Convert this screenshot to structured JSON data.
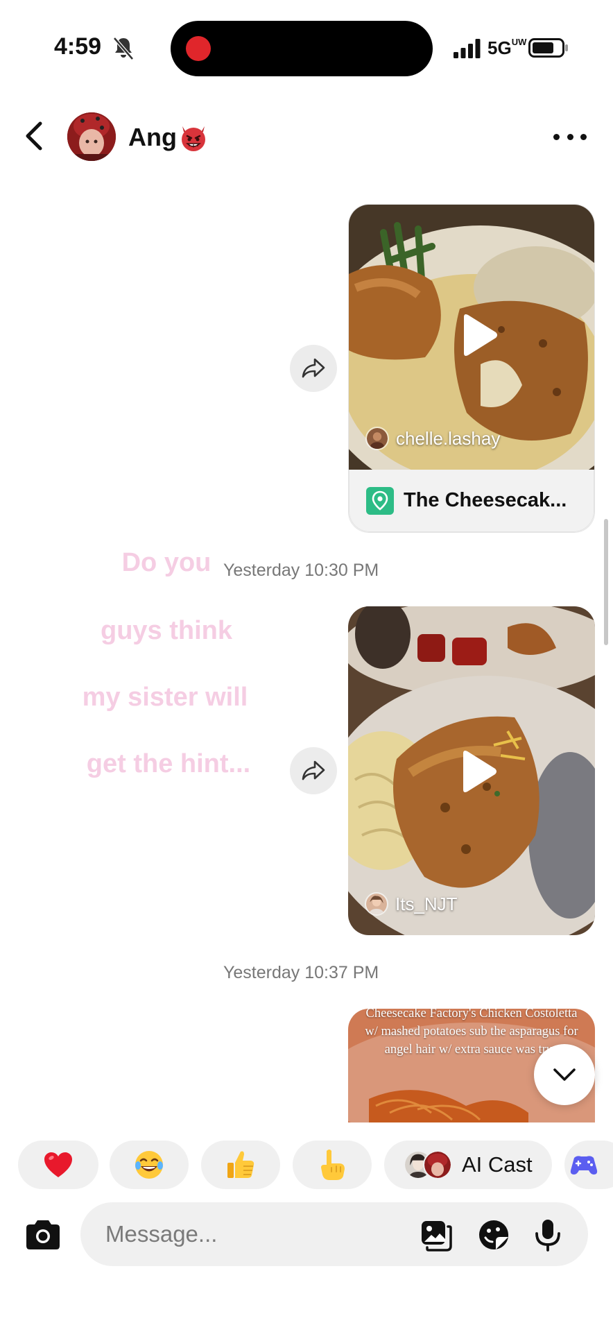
{
  "status_bar": {
    "time": "4:59",
    "network": "5G",
    "network_sub": "UW"
  },
  "header": {
    "contact_name": "Ang",
    "name_emoji_icon": "devil-face-icon"
  },
  "messages": [
    {
      "type": "shared_video",
      "author": "chelle.lashay",
      "place": "The Cheesecak..."
    },
    {
      "type": "timestamp",
      "text": "Yesterday 10:30 PM"
    },
    {
      "type": "shared_video",
      "author": "Its_NJT",
      "overlay_caption": [
        "Do you",
        "guys think",
        "my sister will",
        "get the hint..."
      ]
    },
    {
      "type": "timestamp",
      "text": "Yesterday 10:37 PM"
    },
    {
      "type": "shared_video",
      "caption": "Cheesecake Factory's Chicken Costoletta w/ mashed potatoes sub the asparagus for angel hair w/ extra sauce was true"
    }
  ],
  "quick_reactions": [
    {
      "emoji": "❤️",
      "icon": "heart-icon"
    },
    {
      "emoji": "😂",
      "icon": "laughing-icon"
    },
    {
      "emoji": "👍",
      "icon": "thumbs-up-icon"
    },
    {
      "emoji": "👆",
      "icon": "pointing-hand-icon"
    },
    {
      "label": "AI Cast",
      "icon": "ai-cast-icon"
    },
    {
      "icon": "game-controller-icon"
    }
  ],
  "composer": {
    "placeholder": "Message..."
  },
  "colors": {
    "caption_pink": "#f5cde3",
    "place_pin_green": "#2dbc86",
    "record_red": "#e0262b",
    "game_purple": "#5b5ef0"
  }
}
